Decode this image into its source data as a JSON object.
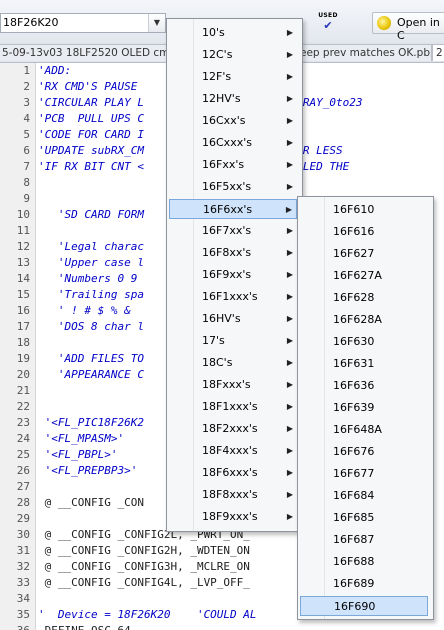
{
  "toolbar": {
    "device_select": "18F26K20",
    "used_label": "USED",
    "open_label": "Open in C"
  },
  "tabs": [
    "5-09-13v03 18LF2520 OLED cmdsC",
    "eep prev matches OK.pbp",
    "2"
  ],
  "code_lines": [
    {
      "n": "1",
      "t": "'ADD:",
      "c": "cmt"
    },
    {
      "n": "2",
      "t": "'RX CMD'S PAUSE",
      "c": "cmt"
    },
    {
      "n": "3",
      "t": "'CIRCULAR PLAY L                M yRX_ARRAY_0to23",
      "c": "cmt"
    },
    {
      "n": "4",
      "t": "'PCB  PULL UPS C              RTB.1",
      "c": "cmt"
    },
    {
      "n": "5",
      "t": "'CODE FOR CARD I             PROTECT",
      "c": "cmt"
    },
    {
      "n": "6",
      "t": "'UPDATE subRX_CM            S STOP CMD OR LESS",
      "c": "cmt"
    },
    {
      "n": "7",
      "t": "'IF RX BIT CNT <              IN TOGGLE LED THE",
      "c": "cmt"
    },
    {
      "n": "8",
      "t": "",
      "c": "cmt"
    },
    {
      "n": "9",
      "t": "",
      "c": "cmt"
    },
    {
      "n": "10",
      "t": "   'SD CARD FORM                                 TT",
      "c": "cmt"
    },
    {
      "n": "11",
      "t": "",
      "c": "cmt"
    },
    {
      "n": "12",
      "t": "   'Legal charac                                 ne",
      "c": "cmt"
    },
    {
      "n": "13",
      "t": "   'Upper case l",
      "c": "cmt"
    },
    {
      "n": "14",
      "t": "   'Numbers 0 9",
      "c": "cmt"
    },
    {
      "n": "15",
      "t": "   'Trailing spa",
      "c": "cmt"
    },
    {
      "n": "16",
      "t": "   ' ! # $ % &",
      "c": "cmt"
    },
    {
      "n": "17",
      "t": "   'DOS 8 char l",
      "c": "cmt"
    },
    {
      "n": "18",
      "t": "",
      "c": "cmt"
    },
    {
      "n": "19",
      "t": "   'ADD FILES TO                                 OF",
      "c": "cmt"
    },
    {
      "n": "20",
      "t": "   'APPEARANCE C                                 OO",
      "c": "cmt"
    },
    {
      "n": "21",
      "t": "",
      "c": "cmt"
    },
    {
      "n": "22",
      "t": "",
      "c": "cmt"
    },
    {
      "n": "23",
      "t": " '<FL_PIC18F26K2",
      "c": "cmt"
    },
    {
      "n": "24",
      "t": " '<FL_MPASM>'",
      "c": "cmt"
    },
    {
      "n": "25",
      "t": " '<FL_PBPL>'",
      "c": "cmt"
    },
    {
      "n": "26",
      "t": " '<FL_PREPBP3>'",
      "c": "cmt"
    },
    {
      "n": "27",
      "t": "",
      "c": "dir"
    },
    {
      "n": "28",
      "t": " @ __CONFIG _CON",
      "c": "dir"
    },
    {
      "n": "29",
      "t": "",
      "c": "dir"
    },
    {
      "n": "30",
      "t": " @ __CONFIG _CONFIG2L, _PWRT_ON_",
      "c": "dir"
    },
    {
      "n": "31",
      "t": " @ __CONFIG _CONFIG2H, _WDTEN_ON                 _2",
      "c": "dir"
    },
    {
      "n": "32",
      "t": " @ __CONFIG _CONFIG3H, _MCLRE_ON                 _O",
      "c": "dir"
    },
    {
      "n": "33",
      "t": " @ __CONFIG _CONFIG4L, _LVP_OFF_                 4L",
      "c": "dir"
    },
    {
      "n": "34",
      "t": "",
      "c": "dir"
    },
    {
      "n": "35",
      "t": "'  Device = 18F26K20    'COULD AL",
      "c": "cmt"
    },
    {
      "n": "36",
      "t": " DEFINE OSC 64",
      "c": "dir"
    }
  ],
  "menu_families": [
    "10's",
    "12C's",
    "12F's",
    "12HV's",
    "16Cxx's",
    "16Cxxx's",
    "16Fxx's",
    "16F5xx's",
    "16F6xx's",
    "16F7xx's",
    "16F8xx's",
    "16F9xx's",
    "16F1xxx's",
    "16HV's",
    "17's",
    "18C's",
    "18Fxxx's",
    "18F1xxx's",
    "18F2xxx's",
    "18F4xxx's",
    "18F6xxx's",
    "18F8xxx's",
    "18F9xxx's"
  ],
  "menu_selected_family": "16F6xx's",
  "menu_devices": [
    "16F610",
    "16F616",
    "16F627",
    "16F627A",
    "16F628",
    "16F628A",
    "16F630",
    "16F631",
    "16F636",
    "16F639",
    "16F648A",
    "16F676",
    "16F677",
    "16F684",
    "16F685",
    "16F687",
    "16F688",
    "16F689",
    "16F690"
  ],
  "menu_selected_device": "16F690"
}
